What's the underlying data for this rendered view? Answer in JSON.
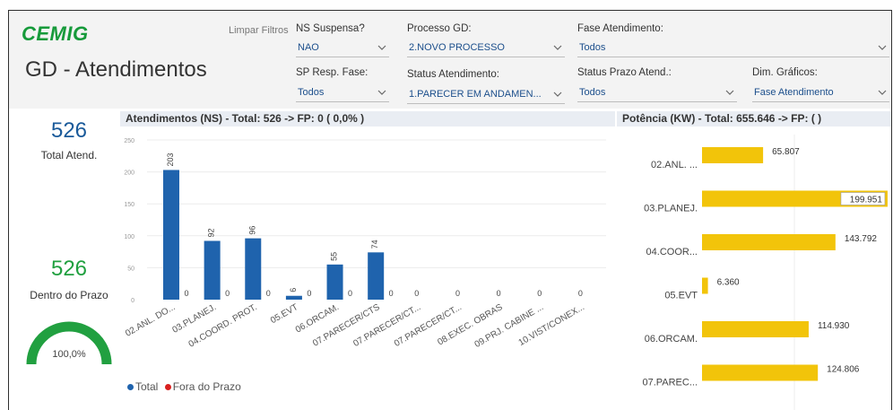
{
  "brand": "CEMIG",
  "page_title": "GD - Atendimentos",
  "clear_filters": "Limpar Filtros",
  "filters": {
    "ns_suspensa": {
      "label": "NS Suspensa?",
      "value": "NAO"
    },
    "processo_gd": {
      "label": "Processo GD:",
      "value": "2.NOVO PROCESSO"
    },
    "fase_atendimento": {
      "label": "Fase Atendimento:",
      "value": "Todos"
    },
    "sp_resp_fase": {
      "label": "SP Resp. Fase:",
      "value": "Todos"
    },
    "status_atendimento": {
      "label": "Status Atendimento:",
      "value": "1.PARECER EM ANDAMEN..."
    },
    "status_prazo": {
      "label": "Status Prazo Atend.:",
      "value": "Todos"
    },
    "dim_graficos": {
      "label": "Dim. Gráficos:",
      "value": "Fase Atendimento"
    }
  },
  "kpis": {
    "total_value": "526",
    "total_label": "Total Atend.",
    "prazo_value": "526",
    "prazo_label": "Dentro do Prazo",
    "gauge_label": "100,0%",
    "gauge_fraction": 1.0
  },
  "colors": {
    "green": "#21a040",
    "blue_kpi": "#1a5a9a",
    "bar_blue": "#1f63ad",
    "bar_yellow": "#f2c40a",
    "fora_red": "#d9201f"
  },
  "chart_data": [
    {
      "type": "bar",
      "title": "Atendimentos (NS) - Total: 526 -> FP: 0 ( 0,0% )",
      "categories": [
        "02.ANL. DO...",
        "03.PLANEJ.",
        "04.COORD. PROT.",
        "05.EVT",
        "06.ORCAM.",
        "07.PARECER/CTS",
        "07.PARECER/CT...",
        "07.PARECER/CT...",
        "08.EXEC. OBRAS",
        "09.PRJ. CABINE ...",
        "10.VIST/CONEX..."
      ],
      "series": [
        {
          "name": "Total",
          "values": [
            203,
            92,
            96,
            6,
            55,
            74,
            0,
            0,
            0,
            0,
            0
          ]
        },
        {
          "name": "Fora do Prazo",
          "values": [
            0,
            0,
            0,
            0,
            0,
            0,
            0,
            0,
            0,
            0,
            0
          ]
        }
      ],
      "y_ticks": [
        0,
        50,
        100,
        150,
        200,
        250
      ],
      "ylim": [
        0,
        250
      ],
      "legend_position": "bottom-left",
      "grid": true
    },
    {
      "type": "bar",
      "orientation": "horizontal",
      "title": "Potência (KW) - Total: 655.646 -> FP: ( )",
      "categories": [
        "02.ANL. ...",
        "03.PLANEJ.",
        "04.COOR...",
        "05.EVT",
        "06.ORCAM.",
        "07.PAREC..."
      ],
      "values": [
        65.807,
        199.951,
        143.792,
        6.36,
        114.93,
        124.806
      ],
      "value_labels": [
        "65.807",
        "199.951",
        "143.792",
        "6.360",
        "114.930",
        "124.806"
      ],
      "xlim": [
        0,
        200
      ]
    }
  ]
}
